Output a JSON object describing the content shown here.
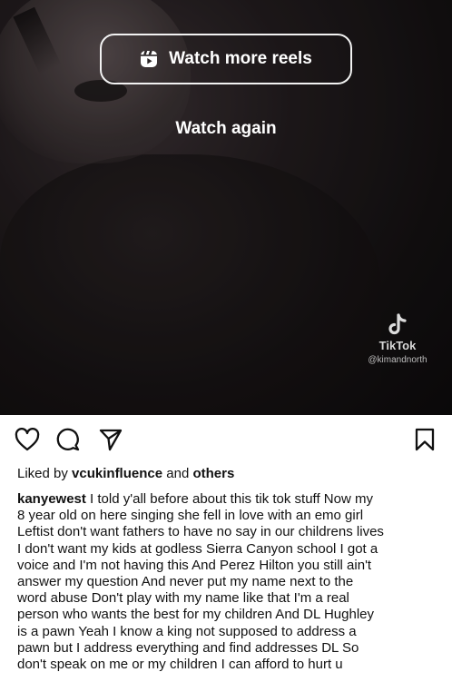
{
  "video": {
    "watch_more_label": "Watch more reels",
    "watch_again_label": "Watch again",
    "tiktok_brand": "TikTok",
    "tiktok_handle": "@kimandnorth"
  },
  "post": {
    "likes_prefix": "Liked by",
    "liked_by_user": "vcukinfluence",
    "likes_and": "and",
    "likes_others": "others",
    "author": "kanyewest",
    "caption_lines": [
      " I told y'all before about this tik tok stuff  Now my",
      "8 year old on here singing she fell in love with an emo girl",
      "Leftist don't want fathers to have no say in our childrens lives",
      "I don't want my kids at godless Sierra Canyon school  I got a",
      "voice and I'm not having this  And Perez Hilton you still ain't",
      "answer my question  And never put my name next to the",
      "word abuse  Don't play with my name like that  I'm a real",
      "person who wants the best for my children  And DL Hughley",
      "is a pawn  Yeah I know a king not supposed to address a",
      "pawn but I address everything and find addresses DL  So",
      "don't speak on me or my children  I can afford to hurt u"
    ]
  },
  "icons": {
    "reels": "reels-icon",
    "tiktok": "tiktok-logo-icon",
    "like": "heart-icon",
    "comment": "comment-icon",
    "share": "send-icon",
    "save": "bookmark-icon"
  }
}
